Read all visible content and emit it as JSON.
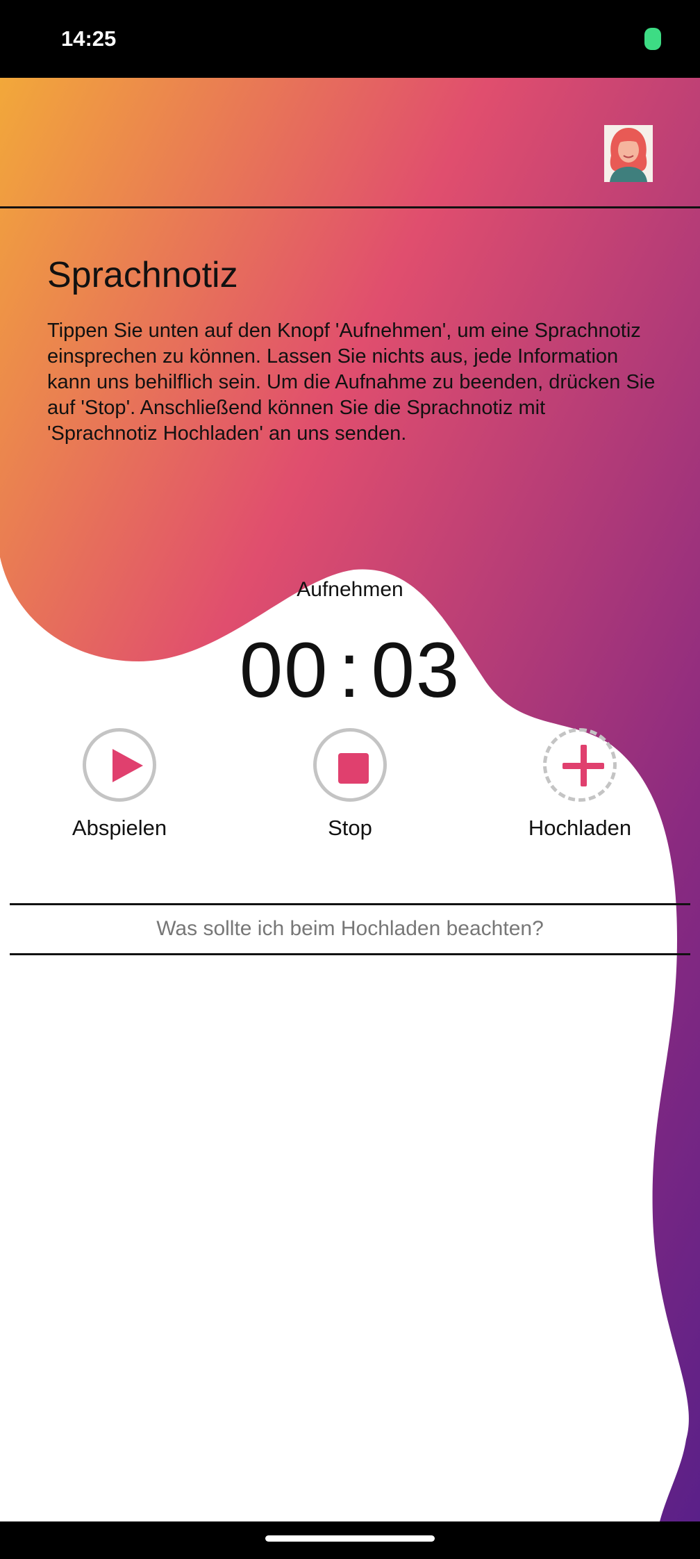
{
  "status_bar": {
    "time": "14:25"
  },
  "header": {
    "avatar_icon": "user-avatar-woman"
  },
  "content": {
    "title": "Sprachnotiz",
    "description": "Tippen Sie unten auf den Knopf 'Aufnehmen', um eine Sprachnotiz einsprechen zu können. Lassen Sie nichts aus, jede Information kann uns behilflich sein. Um die Aufnahme zu beenden, drücken Sie auf 'Stop'. Anschließend können Sie die Sprachnotiz mit 'Sprachnotiz Hochladen' an uns senden."
  },
  "recorder": {
    "label": "Aufnehmen",
    "timer_minutes": "00",
    "timer_separator": ":",
    "timer_seconds": "03"
  },
  "controls": {
    "play_label": "Abspielen",
    "stop_label": "Stop",
    "upload_label": "Hochladen"
  },
  "info": {
    "link_text": "Was sollte ich beim Hochladen beachten?"
  },
  "colors": {
    "accent": "#e0406e",
    "gradient_start": "#f2a83a",
    "gradient_mid": "#e04e6e",
    "gradient_end": "#6a2080",
    "icon_ring": "#c4c4c4"
  }
}
